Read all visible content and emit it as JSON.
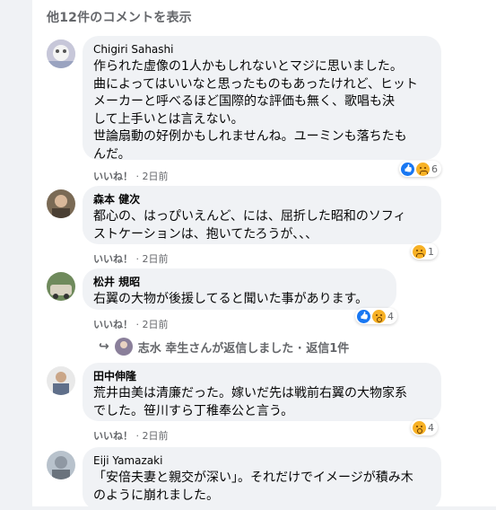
{
  "more_comments": "他12件のコメントを表示",
  "comments": [
    {
      "name": "Chigiri Sahashi",
      "text": [
        "作られた虚像の1人かもしれないとマジに思いました。",
        "曲によってはいいなと思ったものもあったけれど、ヒット",
        "メーカーと呼べるほど国際的な評価も無く、歌唱も決",
        "して上手いとは言えない。",
        "世論扇動の好例かもしれませんね。ユーミンも落ちたも",
        "んだ。"
      ],
      "like": "いいね！",
      "time": "2日前",
      "reaction_count": "6",
      "reactions": [
        "like-icon",
        "sad-icon"
      ]
    },
    {
      "name": "森本 健次",
      "text": [
        "都心の、はっぴいえんど、には、屈折した昭和のソフィ",
        "ストケーションは、抱いてたろうが、、、"
      ],
      "like": "いいね！",
      "time": "2日前",
      "reaction_count": "1",
      "reactions": [
        "sad-icon"
      ]
    },
    {
      "name": "松井 規昭",
      "text": [
        "右翼の大物が後援してると聞いた事があります。"
      ],
      "like": "いいね！",
      "time": "2日前",
      "reaction_count": "4",
      "reactions": [
        "like-icon",
        "wow-icon"
      ]
    },
    {
      "name": "田中伸隆",
      "text": [
        "荒井由美は清廉だった。嫁いだ先は戦前右翼の大物家系",
        "でした。笹川すら丁稚奉公と言う。"
      ],
      "like": "いいね！",
      "time": "2日前",
      "reaction_count": "4",
      "reactions": [
        "wow-icon"
      ]
    },
    {
      "name": "Eiji Yamazaki",
      "text": [
        "「安倍夫妻と親交が深い」。それだけでイメージが積み木",
        "のように崩れました。"
      ]
    }
  ],
  "reply": {
    "text": "志水 幸生さんが返信しました · 返信1件"
  },
  "colors": {
    "page_bg": "#f0f2f5",
    "bubble_bg": "#f0f2f5",
    "like_blue": "#1877f2",
    "emoji_yellow": "#f7b125",
    "meta_gray": "#65676b"
  }
}
